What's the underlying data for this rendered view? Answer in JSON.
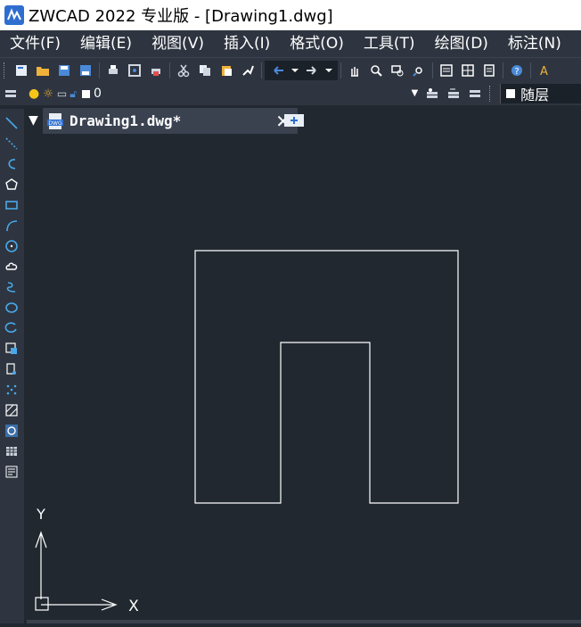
{
  "window": {
    "title": "ZWCAD 2022 专业版 - [Drawing1.dwg]"
  },
  "menu": [
    {
      "label": "文件(F)"
    },
    {
      "label": "编辑(E)"
    },
    {
      "label": "视图(V)"
    },
    {
      "label": "插入(I)"
    },
    {
      "label": "格式(O)"
    },
    {
      "label": "工具(T)"
    },
    {
      "label": "绘图(D)"
    },
    {
      "label": "标注(N)"
    }
  ],
  "toolbar2": {
    "layer_name": "0",
    "linetype": "随层"
  },
  "tab": {
    "title": "Drawing1.dwg*",
    "close_glyph": "✕"
  },
  "ucs": {
    "x_label": "X",
    "y_label": "Y"
  },
  "colors": {
    "background": "#212830",
    "panel": "#2e3540",
    "accent": "#2f6ecf",
    "line": "#ffffff"
  }
}
